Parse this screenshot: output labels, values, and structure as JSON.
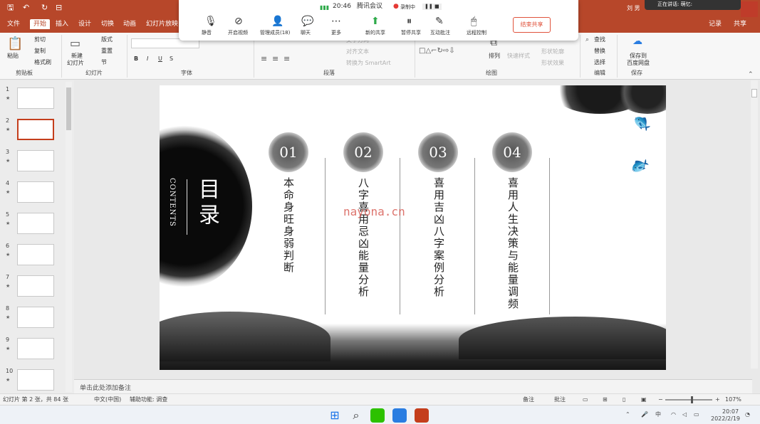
{
  "titlebar": {
    "user": "刘 男",
    "notice": "正在讲话: 萌忆:"
  },
  "tabs": [
    "文件",
    "开始",
    "插入",
    "设计",
    "切换",
    "动画",
    "幻灯片放映"
  ],
  "tabs_right": {
    "record": "记录",
    "share": "共享"
  },
  "ribbon": {
    "clipboard": {
      "paste": "粘贴",
      "cut": "剪切",
      "copy": "复制",
      "format_painter": "格式刷",
      "group": "剪贴板"
    },
    "slides": {
      "new_slide_1": "新建",
      "new_slide_2": "幻灯片",
      "layout": "版式",
      "reset": "重置",
      "section": "节",
      "group": "幻灯片"
    },
    "font": {
      "group": "字体",
      "bold": "B",
      "italic": "I",
      "underline": "U",
      "strike": "S"
    },
    "paragraph": {
      "group": "段落",
      "text_dir": "文字方向",
      "align": "对齐文本",
      "smartart": "转换为 SmartArt"
    },
    "drawing": {
      "group": "绘图",
      "arrange": "排列",
      "quick_styles": "快速样式",
      "shape_outline": "形状轮廓",
      "shape_effect": "形状效果"
    },
    "editing": {
      "group": "编辑",
      "find": "查找",
      "replace": "替换",
      "select": "选择"
    },
    "save": {
      "group": "保存",
      "save_to_1": "保存到",
      "save_to_2": "百度网盘"
    }
  },
  "meeting": {
    "time": "20:46",
    "app": "腾讯会议",
    "recording": "录制中",
    "buttons": [
      "静音",
      "开启视频",
      "管理成员(18)",
      "聊天",
      "更多",
      "新的共享",
      "暂停共享",
      "互动批注",
      "远程控制"
    ],
    "end_share": "结束共享"
  },
  "thumbnails": [
    "1",
    "2",
    "3",
    "4",
    "5",
    "6",
    "7",
    "8",
    "9",
    "10"
  ],
  "thumb_star": "★",
  "slide": {
    "title": "目录",
    "contents": "CONTENTS",
    "sections": [
      {
        "num": "01",
        "text": "本命身旺身弱判断"
      },
      {
        "num": "02",
        "text": "八字喜用忌凶能量分析"
      },
      {
        "num": "03",
        "text": "喜用吉凶八字案例分析"
      },
      {
        "num": "04",
        "text": "喜用人生决策与能量调频"
      }
    ],
    "watermark": "nayona.cn"
  },
  "notes": {
    "placeholder": "单击此处添加备注"
  },
  "status": {
    "slide_info": "幻灯片 第 2 张，共 84 张",
    "language": "中文(中国)",
    "accessibility": "辅助功能: 调查",
    "notes": "备注",
    "comments": "批注",
    "zoom": "107%",
    "zoom_level": 0.55
  },
  "taskbar": {
    "time": "20:07",
    "date": "2022/2/19",
    "ime": "中"
  },
  "colors": {
    "accent": "#b7472a",
    "end_share": "#e0533c",
    "selected_thumb": "#c43e1c"
  }
}
